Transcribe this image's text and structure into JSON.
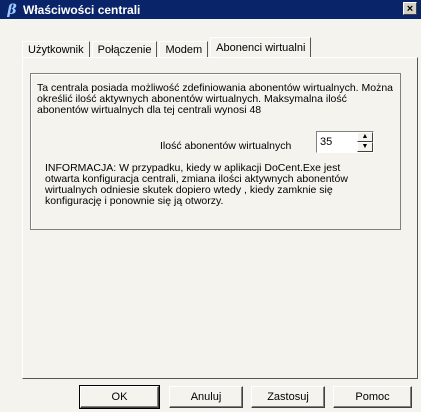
{
  "window": {
    "title": "Właściwości centrali",
    "app_icon": "β",
    "close_label": "×"
  },
  "tabs": [
    {
      "label": "Użytkownik"
    },
    {
      "label": "Połączenie"
    },
    {
      "label": "Modem"
    },
    {
      "label": "Abonenci wirtualni"
    }
  ],
  "panel": {
    "description": "Ta centrala posiada możliwość zdefiniowania abonentów wirtualnych. Można określić ilość aktywnych abonentów wirtualnych. Maksymalna ilość abonentów wirtualnych dla tej centrali wynosi 48",
    "count_label": "Ilość abonentów wirtualnych",
    "count_value": "35",
    "info": "INFORMACJA: W przypadku, kiedy w aplikacji DoCent.Exe jest otwarta konfiguracja centrali, zmiana ilości aktywnych abonentów wirtualnych odniesie skutek dopiero wtedy , kiedy zamknie się konfigurację i ponownie się ją otworzy."
  },
  "buttons": {
    "ok": "OK",
    "cancel": "Anuluj",
    "apply": "Zastosuj",
    "help": "Pomoc"
  }
}
